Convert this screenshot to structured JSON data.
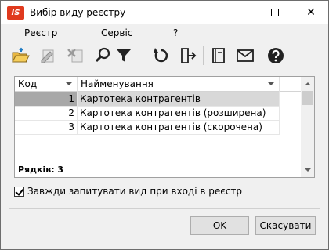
{
  "window": {
    "title": "Вибір виду реєстру",
    "logo_text": "IS"
  },
  "menu": {
    "items": [
      "Реєстр",
      "Сервіс",
      "?"
    ]
  },
  "toolbar": {
    "icons": [
      "open-folder-icon",
      "edit-icon",
      "delete-icon",
      "search-icon",
      "filter-icon",
      "refresh-icon",
      "export-icon",
      "notebook-icon",
      "mail-icon",
      "help-icon"
    ]
  },
  "grid": {
    "columns": [
      "Код",
      "Найменування"
    ],
    "rows": [
      {
        "code": "1",
        "name": "Картотека контрагентів",
        "selected": true
      },
      {
        "code": "2",
        "name": "Картотека контрагентів (розширена)",
        "selected": false
      },
      {
        "code": "3",
        "name": "Картотека контрагентів (скорочена)",
        "selected": false
      }
    ],
    "rows_count": "Рядків: 3"
  },
  "options": {
    "always_ask_label": "Завжди запитувати вид при вході в реєстр",
    "always_ask_checked": true
  },
  "buttons": {
    "ok": "OK",
    "cancel": "Скасувати"
  },
  "colors": {
    "logo": "#e03a1e",
    "selected_row": "#d8d8d8"
  }
}
